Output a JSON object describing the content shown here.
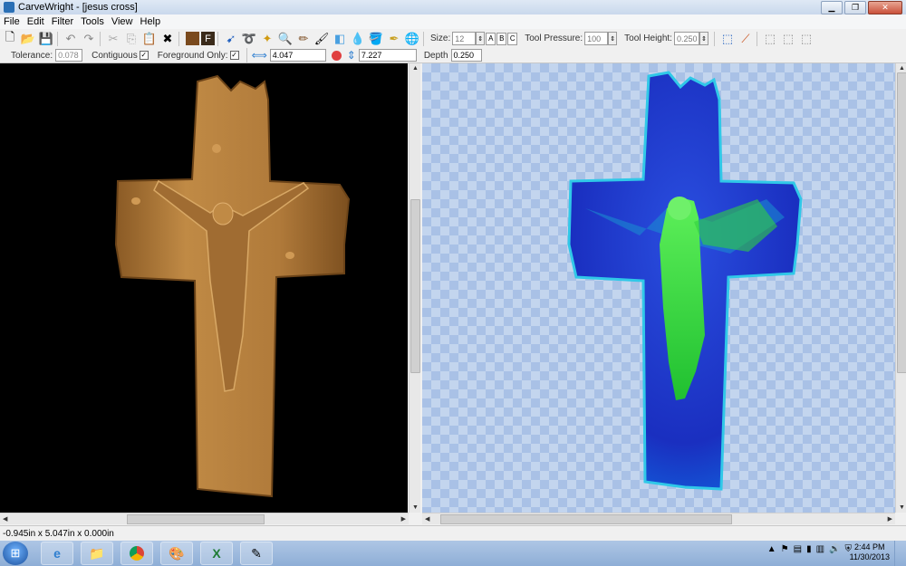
{
  "window": {
    "title": "CarveWright - [jesus cross]"
  },
  "menu": [
    "File",
    "Edit",
    "Filter",
    "Tools",
    "View",
    "Help"
  ],
  "toolbar": {
    "size_label": "Size:",
    "size_value": "12",
    "abc": [
      "A",
      "B",
      "C"
    ],
    "tool_pressure_label": "Tool Pressure:",
    "tool_pressure_value": "100",
    "tool_height_label": "Tool Height:",
    "tool_height_value": "0.250"
  },
  "toolbar2": {
    "tolerance_label": "Tolerance:",
    "tolerance_value": "0.078",
    "contiguous_label": "Contiguous",
    "foreground_only_label": "Foreground Only:",
    "width_value": "4.047",
    "height_value": "7.227",
    "depth_label": "Depth",
    "depth_value": "0.250"
  },
  "status": {
    "text": "-0.945in x 5.047in x 0.000in"
  },
  "taskbar": {
    "apps": [
      "internet-explorer-icon",
      "file-explorer-icon",
      "chrome-icon",
      "paint-icon",
      "excel-icon",
      "carvewright-icon"
    ],
    "time": "2:44 PM",
    "date": "11/30/2013"
  },
  "colors": {
    "carve_wood": "#b07a3a",
    "depth_blue": "#1f3fd0",
    "depth_green": "#35d23a",
    "canvas_checker": "#c3d5ee"
  }
}
